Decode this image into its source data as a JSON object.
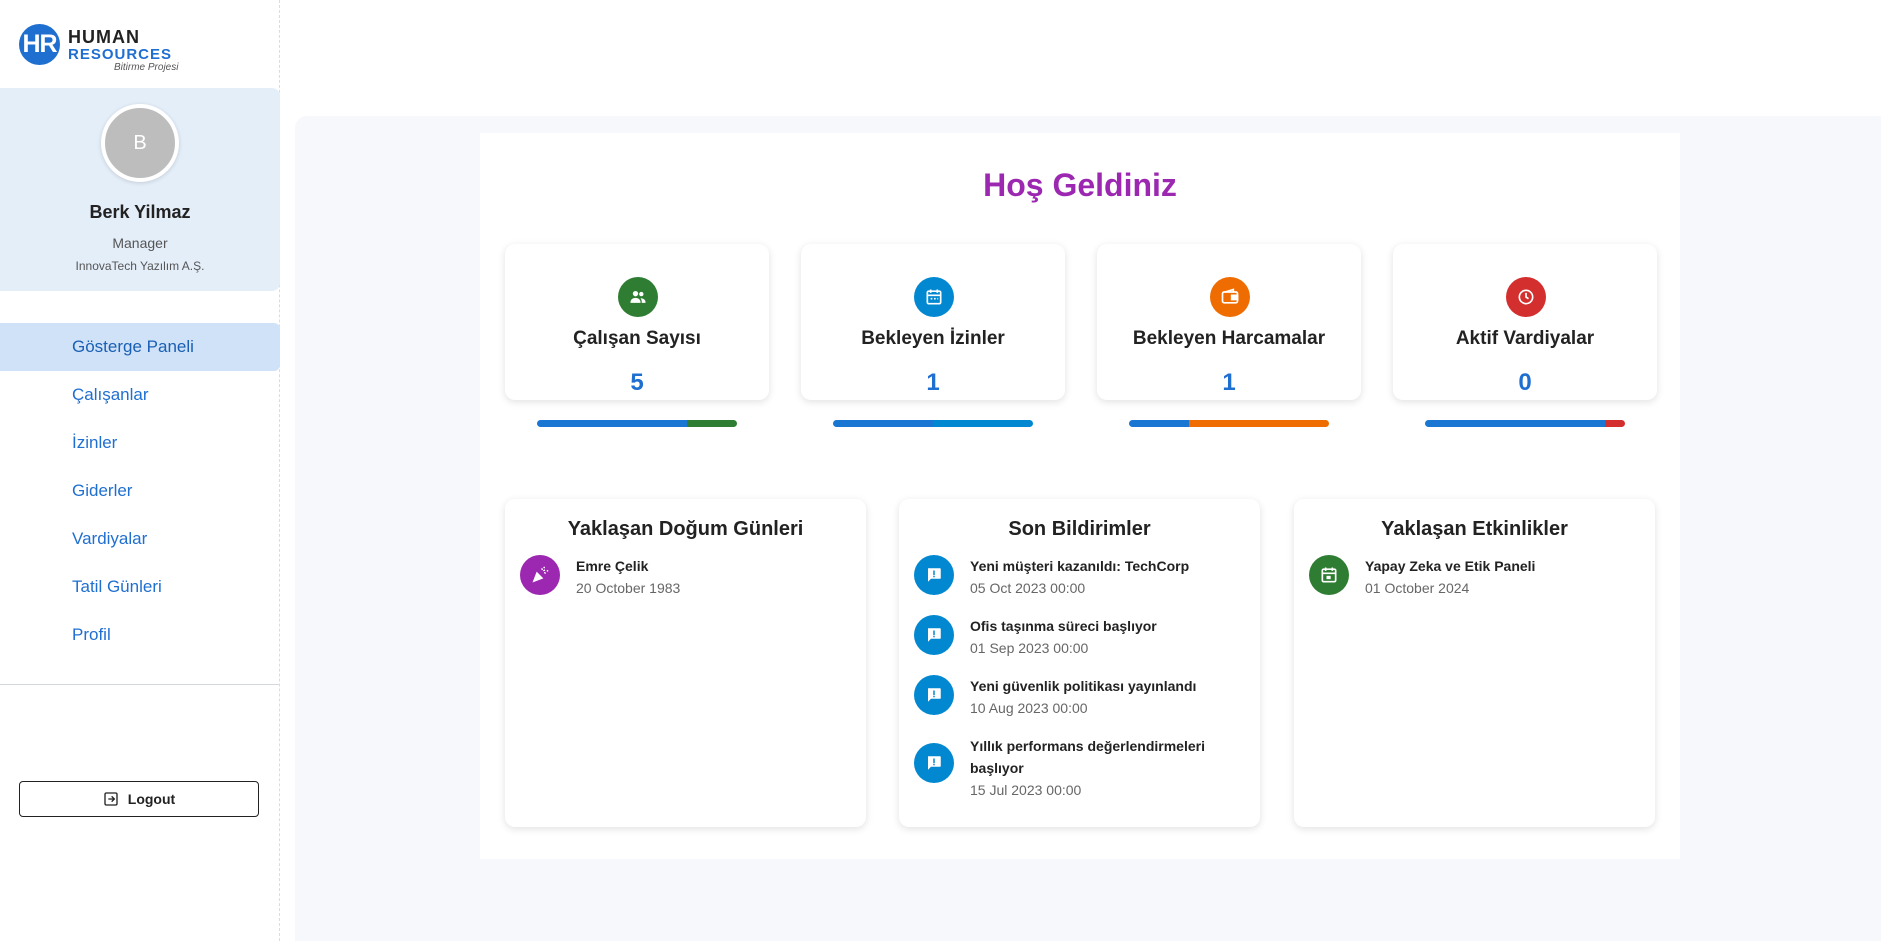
{
  "brand": {
    "badge": "HR",
    "line1": "HUMAN",
    "line2": "RESOURCES",
    "tagline": "Bitirme Projesi"
  },
  "profile": {
    "initial": "B",
    "name": "Berk Yilmaz",
    "role": "Manager",
    "company": "InnovaTech Yazılım A.Ş."
  },
  "nav": {
    "items": [
      {
        "label": "Gösterge Paneli"
      },
      {
        "label": "Çalışanlar"
      },
      {
        "label": "İzinler"
      },
      {
        "label": "Giderler"
      },
      {
        "label": "Vardiyalar"
      },
      {
        "label": "Tatil Günleri"
      },
      {
        "label": "Profil"
      }
    ]
  },
  "logout_label": "Logout",
  "welcome": "Hoş Geldiniz",
  "stats": [
    {
      "title": "Çalışan Sayısı",
      "value": "5",
      "icon": "people-icon",
      "color": "#2e7d32",
      "bar_fraction": 0.75,
      "bar_colors": [
        "#1976d2",
        "#2e7d32"
      ]
    },
    {
      "title": "Bekleyen İzinler",
      "value": "1",
      "icon": "calendar-icon",
      "color": "#0288d1",
      "bar_fraction": 0.5,
      "bar_colors": [
        "#1976d2",
        "#0288d1"
      ]
    },
    {
      "title": "Bekleyen Harcamalar",
      "value": "1",
      "icon": "wallet-icon",
      "color": "#ef6c00",
      "bar_fraction": 0.3,
      "bar_colors": [
        "#1976d2",
        "#ef6c00"
      ]
    },
    {
      "title": "Aktif Vardiyalar",
      "value": "0",
      "icon": "clock-icon",
      "color": "#d32f2f",
      "bar_fraction": 0.9,
      "bar_colors": [
        "#1976d2",
        "#d32f2f"
      ]
    }
  ],
  "birthdays": {
    "title": "Yaklaşan Doğum Günleri",
    "items": [
      {
        "name": "Emre Çelik",
        "date": "20 October 1983"
      }
    ]
  },
  "notifications": {
    "title": "Son Bildirimler",
    "items": [
      {
        "title": "Yeni müşteri kazanıldı: TechCorp",
        "date": "05 Oct 2023 00:00"
      },
      {
        "title": "Ofis taşınma süreci başlıyor",
        "date": "01 Sep 2023 00:00"
      },
      {
        "title": "Yeni güvenlik politikası yayınlandı",
        "date": "10 Aug 2023 00:00"
      },
      {
        "title": "Yıllık performans değerlendirmeleri başlıyor",
        "date": "15 Jul 2023 00:00"
      }
    ]
  },
  "events": {
    "title": "Yaklaşan Etkinlikler",
    "items": [
      {
        "title": "Yapay Zeka ve Etik Paneli",
        "date": "01 October 2024"
      }
    ]
  },
  "colors": {
    "accent": "#1f6fd1",
    "welcome": "#9c27b0",
    "birthday_icon": "#9c27b0",
    "notification_icon": "#0288d1",
    "event_icon": "#2e7d32"
  }
}
